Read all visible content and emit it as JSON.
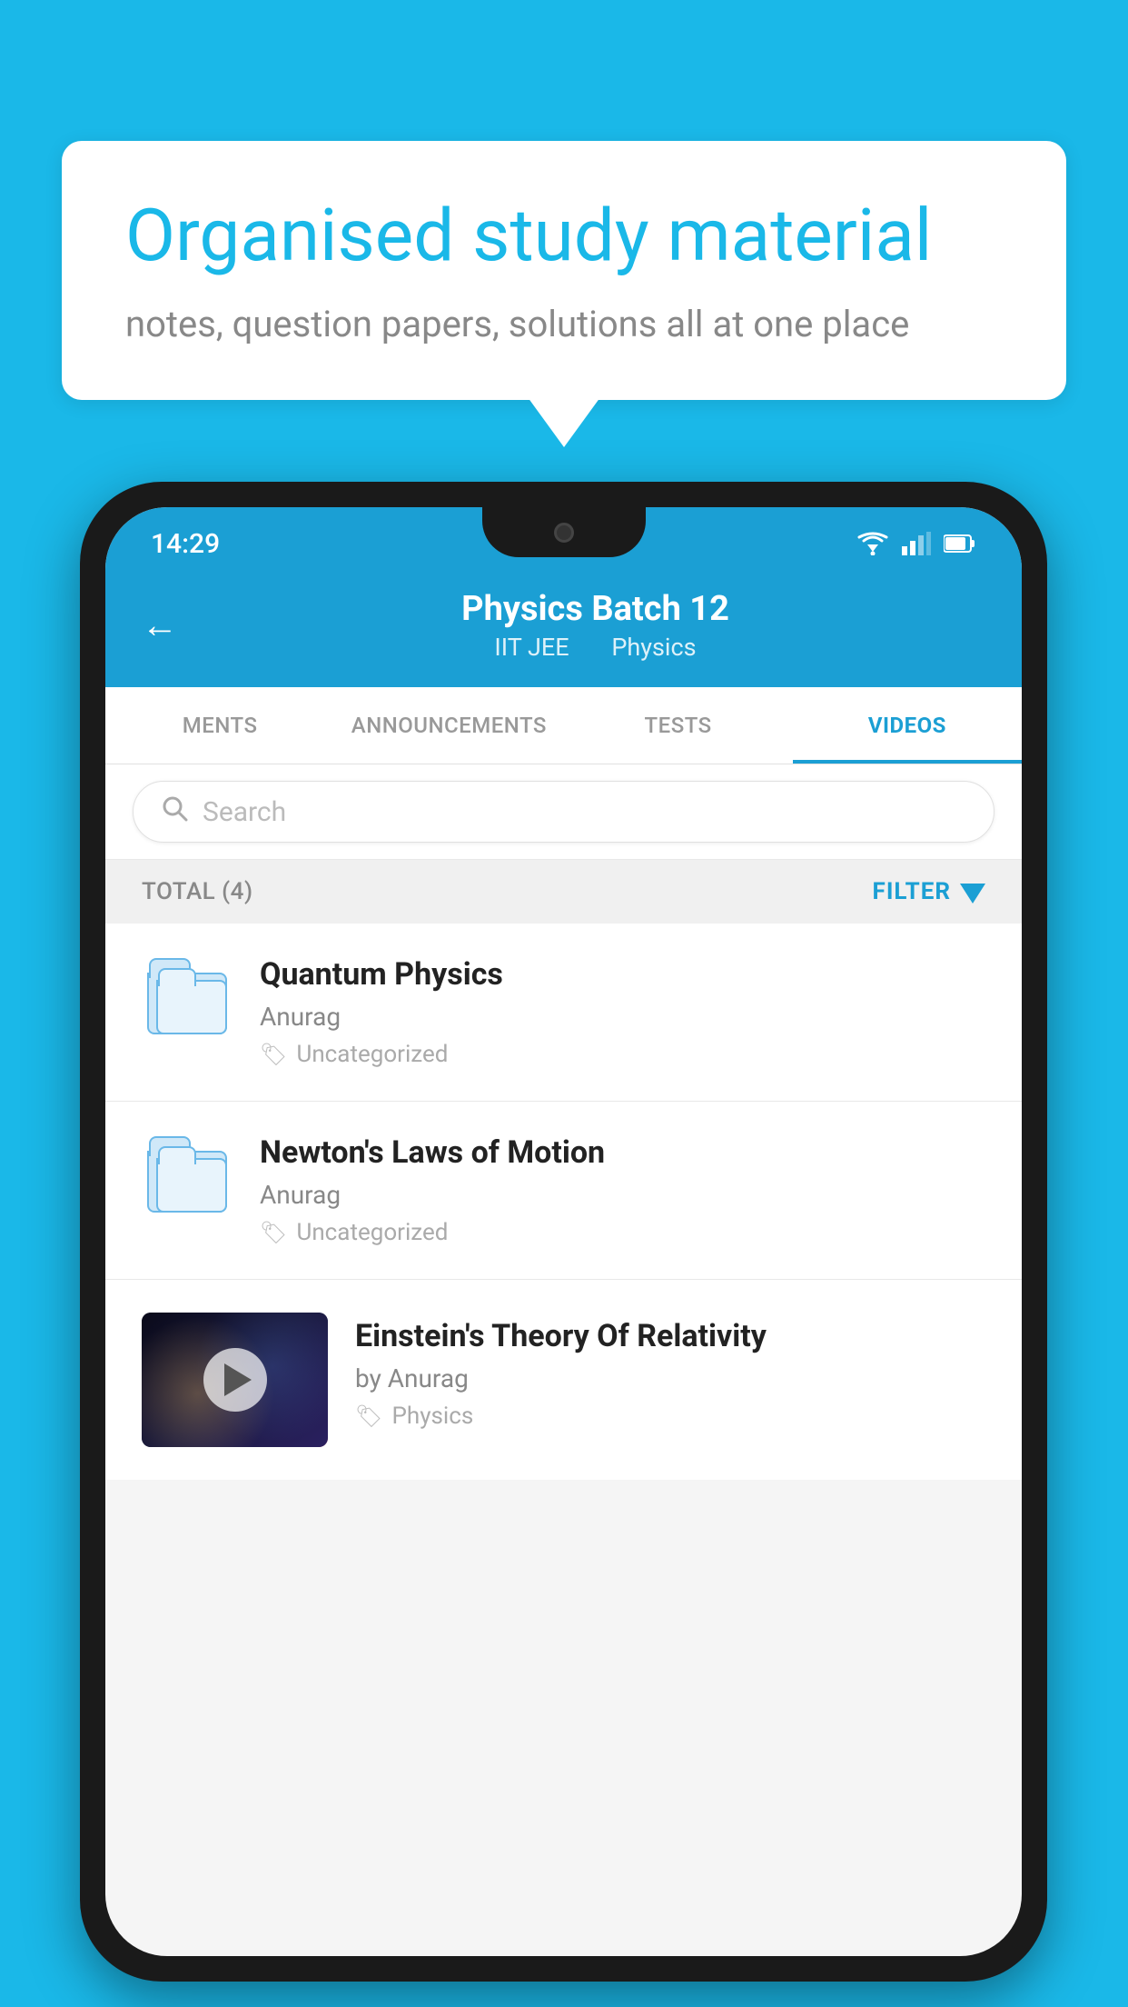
{
  "hero": {
    "title": "Organised study material",
    "subtitle": "notes, question papers, solutions all at one place"
  },
  "status_bar": {
    "time": "14:29"
  },
  "app_header": {
    "back_label": "←",
    "title": "Physics Batch 12",
    "sub1": "IIT JEE",
    "sub2": "Physics"
  },
  "tabs": [
    {
      "label": "MENTS",
      "active": false
    },
    {
      "label": "ANNOUNCEMENTS",
      "active": false
    },
    {
      "label": "TESTS",
      "active": false
    },
    {
      "label": "VIDEOS",
      "active": true
    }
  ],
  "search": {
    "placeholder": "Search"
  },
  "filter_bar": {
    "total_label": "TOTAL (4)",
    "filter_label": "FILTER"
  },
  "videos": [
    {
      "title": "Quantum Physics",
      "author": "Anurag",
      "tag": "Uncategorized",
      "has_thumb": false
    },
    {
      "title": "Newton's Laws of Motion",
      "author": "Anurag",
      "tag": "Uncategorized",
      "has_thumb": false
    },
    {
      "title": "Einstein's Theory Of Relativity",
      "author": "by Anurag",
      "tag": "Physics",
      "has_thumb": true
    }
  ]
}
